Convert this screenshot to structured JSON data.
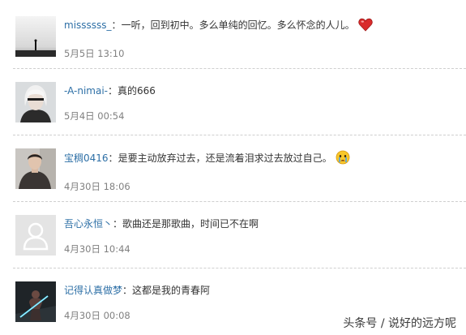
{
  "comments": [
    {
      "user": "missssss_",
      "text": "一听，回到初中。多么单纯的回忆。多么怀念的人儿。",
      "time": "5月5日 13:10",
      "emoji": "heart-icon",
      "avatar": "silhouette-avatar"
    },
    {
      "user": "-A-nimai-",
      "text": "真的666",
      "time": "5月4日 00:54",
      "avatar": "white-hair-character-avatar"
    },
    {
      "user": "宝稠0416",
      "text": "是要主动放弃过去，还是流着泪求过去放过自己。",
      "time": "4月30日 18:06",
      "emoji": "crying-face-icon",
      "avatar": "person-avatar"
    },
    {
      "user": "吾心永恒丶",
      "text": "歌曲还是那歌曲，时间已不在啊",
      "time": "4月30日 10:44",
      "avatar": "default-user-avatar"
    },
    {
      "user": "记得认真做梦",
      "text": "这都是我的青春阿",
      "time": "4月30日 00:08",
      "avatar": "armored-character-avatar"
    }
  ],
  "separator": "：",
  "watermark": "头条号 / 说好的远方呢",
  "colors": {
    "username": "#2d6fa6",
    "text": "#333333",
    "time": "#808080",
    "separator_line": "#cfcfcf"
  }
}
